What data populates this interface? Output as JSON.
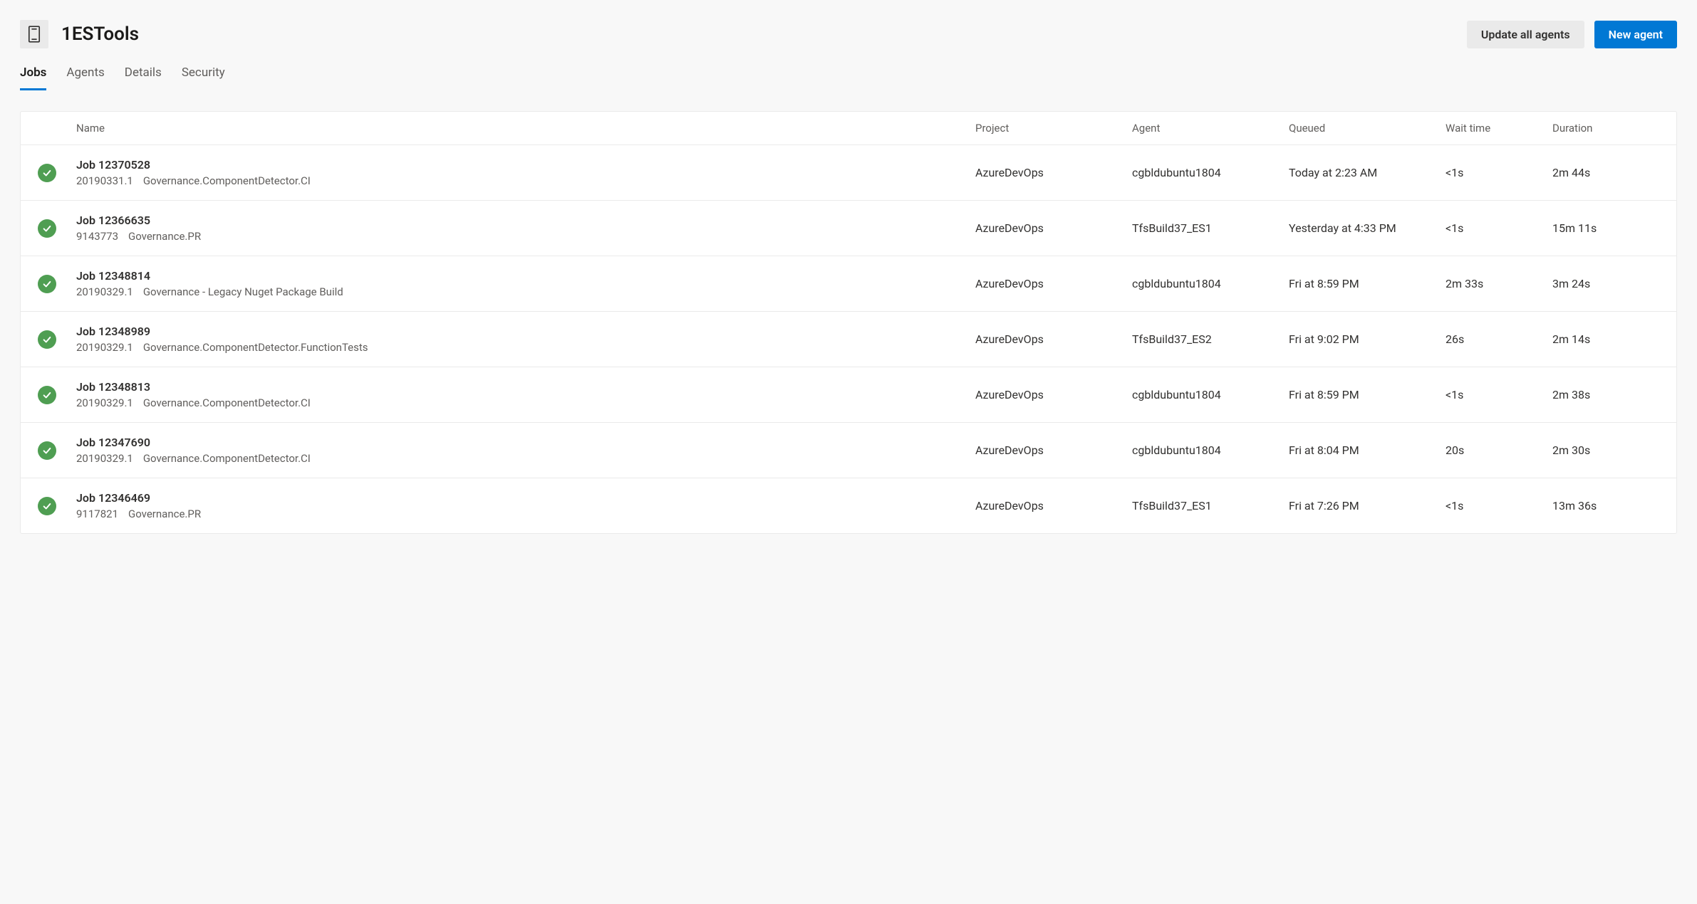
{
  "header": {
    "title": "1ESTools",
    "updateAllButton": "Update all agents",
    "newAgentButton": "New agent"
  },
  "tabs": [
    {
      "label": "Jobs",
      "active": true
    },
    {
      "label": "Agents",
      "active": false
    },
    {
      "label": "Details",
      "active": false
    },
    {
      "label": "Security",
      "active": false
    }
  ],
  "columns": {
    "name": "Name",
    "project": "Project",
    "agent": "Agent",
    "queued": "Queued",
    "waitTime": "Wait time",
    "duration": "Duration"
  },
  "jobs": [
    {
      "status": "success",
      "name": "Job 12370528",
      "buildNumber": "20190331.1",
      "pipeline": "Governance.ComponentDetector.CI",
      "project": "AzureDevOps",
      "agent": "cgbldubuntu1804",
      "queued": "Today at 2:23 AM",
      "waitTime": "<1s",
      "duration": "2m 44s"
    },
    {
      "status": "success",
      "name": "Job 12366635",
      "buildNumber": "9143773",
      "pipeline": "Governance.PR",
      "project": "AzureDevOps",
      "agent": "TfsBuild37_ES1",
      "queued": "Yesterday at 4:33 PM",
      "waitTime": "<1s",
      "duration": "15m 11s"
    },
    {
      "status": "success",
      "name": "Job 12348814",
      "buildNumber": "20190329.1",
      "pipeline": "Governance - Legacy Nuget Package Build",
      "project": "AzureDevOps",
      "agent": "cgbldubuntu1804",
      "queued": "Fri at 8:59 PM",
      "waitTime": "2m 33s",
      "duration": "3m 24s"
    },
    {
      "status": "success",
      "name": "Job 12348989",
      "buildNumber": "20190329.1",
      "pipeline": "Governance.ComponentDetector.FunctionTests",
      "project": "AzureDevOps",
      "agent": "TfsBuild37_ES2",
      "queued": "Fri at 9:02 PM",
      "waitTime": "26s",
      "duration": "2m 14s"
    },
    {
      "status": "success",
      "name": "Job 12348813",
      "buildNumber": "20190329.1",
      "pipeline": "Governance.ComponentDetector.CI",
      "project": "AzureDevOps",
      "agent": "cgbldubuntu1804",
      "queued": "Fri at 8:59 PM",
      "waitTime": "<1s",
      "duration": "2m 38s"
    },
    {
      "status": "success",
      "name": "Job 12347690",
      "buildNumber": "20190329.1",
      "pipeline": "Governance.ComponentDetector.CI",
      "project": "AzureDevOps",
      "agent": "cgbldubuntu1804",
      "queued": "Fri at 8:04 PM",
      "waitTime": "20s",
      "duration": "2m 30s"
    },
    {
      "status": "success",
      "name": "Job 12346469",
      "buildNumber": "9117821",
      "pipeline": "Governance.PR",
      "project": "AzureDevOps",
      "agent": "TfsBuild37_ES1",
      "queued": "Fri at 7:26 PM",
      "waitTime": "<1s",
      "duration": "13m 36s"
    }
  ]
}
